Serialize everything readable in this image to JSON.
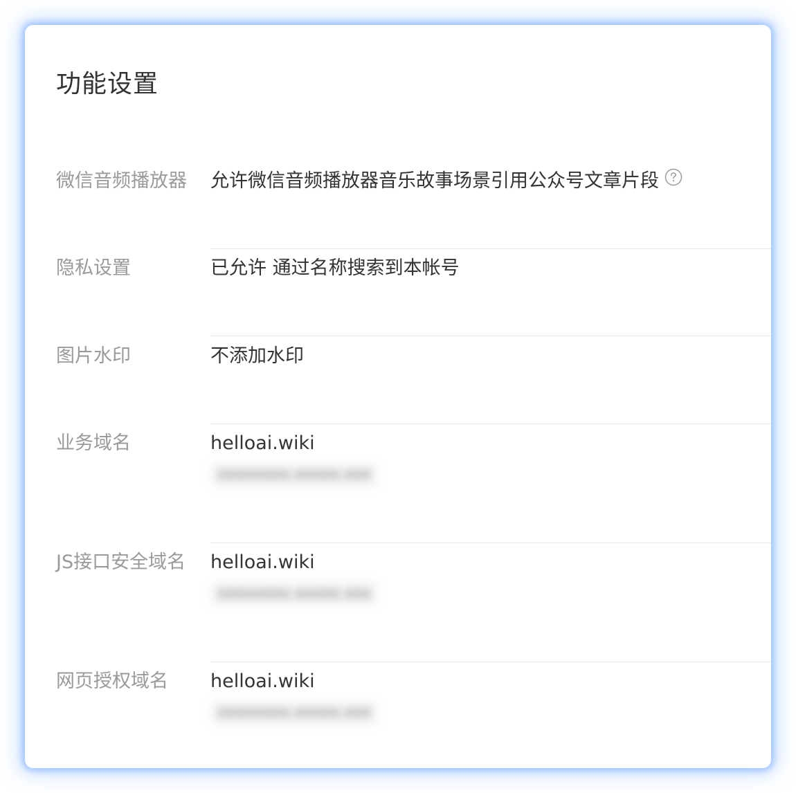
{
  "page": {
    "title": "功能设置"
  },
  "settings": [
    {
      "label": "微信音频播放器",
      "value": "允许微信音频播放器音乐故事场景引用公众号文章片段",
      "has_help": true,
      "icon": "help-circle-icon"
    },
    {
      "label": "隐私设置",
      "value": "已允许 通过名称搜索到本帐号"
    },
    {
      "label": "图片水印",
      "value": "不添加水印"
    },
    {
      "label": "业务域名",
      "value": "helloai.wiki",
      "secondary": "xxxxxxxx.xxxxx.xxx"
    },
    {
      "label": "JS接口安全域名",
      "value": "helloai.wiki",
      "secondary": "xxxxxxxx.xxxxx.xxx"
    },
    {
      "label": "网页授权域名",
      "value": "helloai.wiki",
      "secondary": "xxxxxxxx.xxxxx.xxx"
    }
  ],
  "colors": {
    "glow": "#7fb2ff",
    "label_text": "#9a9a9a",
    "value_text": "#333333",
    "divider": "#e6e6e6"
  }
}
